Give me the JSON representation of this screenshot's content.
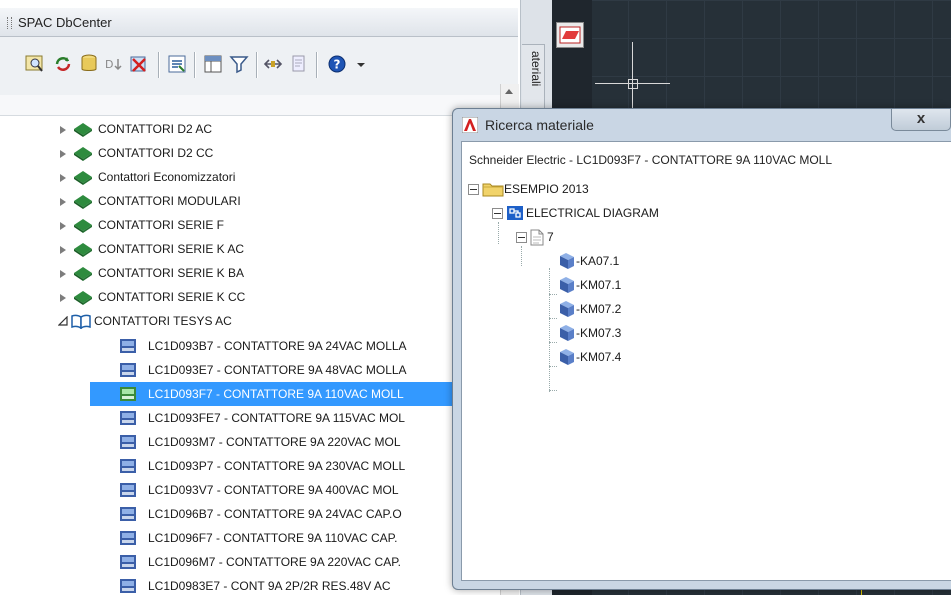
{
  "panel": {
    "title": "SPAC DbCenter",
    "side_tab_label": "ateriali"
  },
  "toolbar": {
    "buttons": [
      "zoom-icon",
      "refresh-icon",
      "database-icon",
      "sort-icon",
      "delete-icon",
      "properties-icon",
      "table-icon",
      "filter-icon",
      "compare-icon",
      "report-icon",
      "help-icon"
    ]
  },
  "tree": {
    "categories": [
      {
        "label": "CONTATTORI D2 AC",
        "expanded": false
      },
      {
        "label": "CONTATTORI D2 CC",
        "expanded": false
      },
      {
        "label": "Contattori Economizzatori",
        "expanded": false
      },
      {
        "label": "CONTATTORI MODULARI",
        "expanded": false
      },
      {
        "label": "CONTATTORI SERIE F",
        "expanded": false
      },
      {
        "label": "CONTATTORI SERIE K AC",
        "expanded": false
      },
      {
        "label": "CONTATTORI SERIE K BA",
        "expanded": false
      },
      {
        "label": "CONTATTORI SERIE K CC",
        "expanded": false
      },
      {
        "label": "CONTATTORI TESYS AC",
        "expanded": true
      }
    ],
    "items": [
      {
        "label": "LC1D093B7 - CONTATTORE 9A 24VAC MOLLA",
        "selected": false
      },
      {
        "label": "LC1D093E7 - CONTATTORE 9A 48VAC MOLLA",
        "selected": false
      },
      {
        "label": "LC1D093F7 - CONTATTORE 9A 110VAC MOLL",
        "selected": true
      },
      {
        "label": "LC1D093FE7 - CONTATTORE 9A 115VAC MOL",
        "selected": false
      },
      {
        "label": "LC1D093M7 - CONTATTORE 9A 220VAC MOL",
        "selected": false
      },
      {
        "label": "LC1D093P7 - CONTATTORE 9A 230VAC MOLL",
        "selected": false
      },
      {
        "label": "LC1D093V7 - CONTATTORE 9A 400VAC MOL",
        "selected": false
      },
      {
        "label": "LC1D096B7 - CONTATTORE 9A 24VAC CAP.O",
        "selected": false
      },
      {
        "label": "LC1D096F7 - CONTATTORE 9A 110VAC CAP.",
        "selected": false
      },
      {
        "label": "LC1D096M7 - CONTATTORE 9A 220VAC CAP.",
        "selected": false
      },
      {
        "label": "LC1D0983E7 - CONT 9A 2P/2R RES.48V AC",
        "selected": false
      }
    ]
  },
  "dialog": {
    "title": "Ricerca materiale",
    "close_label": "x",
    "header": "Schneider Electric  -  LC1D093F7  -  CONTATTORE 9A 110VAC MOLL",
    "project": "ESEMPIO 2013",
    "diagram": "ELECTRICAL DIAGRAM",
    "sheet": "7",
    "components": [
      "-KA07.1",
      "-KM07.1",
      "-KM07.2",
      "-KM07.3",
      "-KM07.4"
    ]
  },
  "colors": {
    "selection": "#3399ff",
    "book_green": "#2e8b3e",
    "cad_background": "#263038"
  }
}
